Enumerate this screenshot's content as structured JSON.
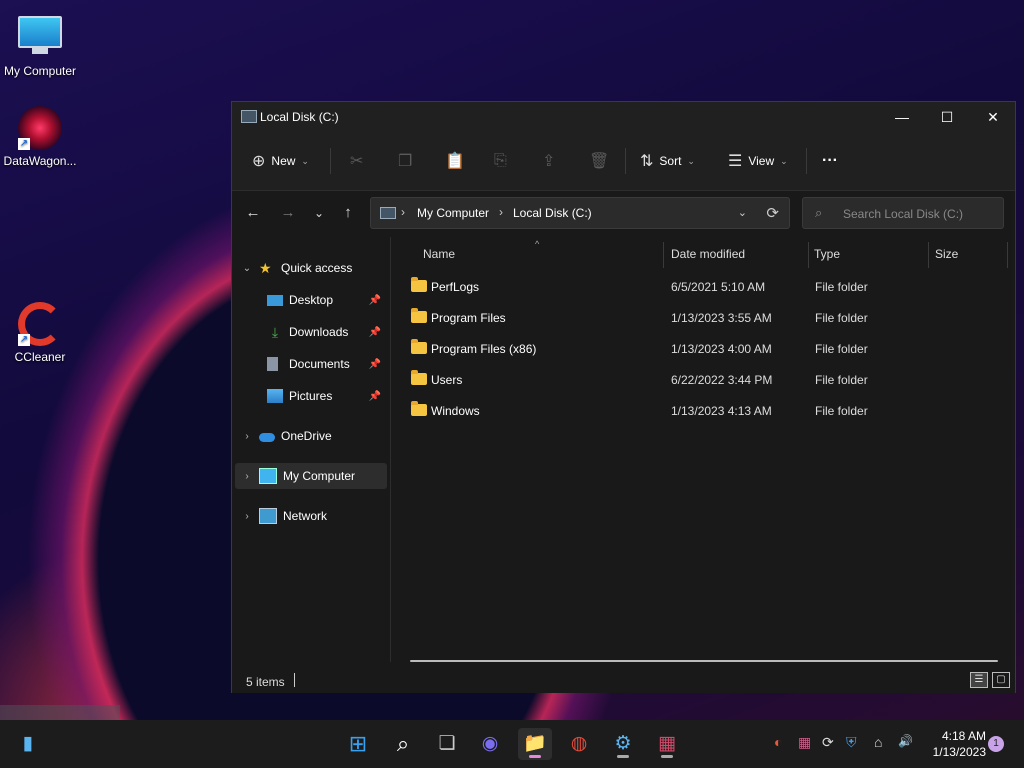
{
  "desktop": {
    "icons": [
      {
        "label": "My Computer",
        "icon": "monitor-icon"
      },
      {
        "label": "DataWagon...",
        "icon": "datawagon-icon"
      },
      {
        "label": "CCleaner",
        "icon": "ccleaner-icon"
      }
    ]
  },
  "window": {
    "title": "Local Disk (C:)",
    "controls": {
      "minimize": "—",
      "maximize": "☐",
      "close": "✕"
    }
  },
  "toolbar": {
    "new_label": "New",
    "sort_label": "Sort",
    "view_label": "View",
    "more_label": "···",
    "icons": {
      "new": "⊕",
      "cut": "✂",
      "copy": "❐",
      "paste": "📋",
      "rename": "⎘",
      "share": "⇪",
      "delete": "🗑",
      "sort": "⇅",
      "view": "☰"
    }
  },
  "nav": {
    "back": "←",
    "forward": "→",
    "recent": "⌄",
    "up": "↑",
    "breadcrumb": [
      "My Computer",
      "Local Disk (C:)"
    ],
    "crumb_sep": "›",
    "refresh": "⟳",
    "search_placeholder": "Search Local Disk (C:)",
    "search_icon": "⌕"
  },
  "sidebar": {
    "quick_access": "Quick access",
    "items": [
      {
        "label": "Desktop",
        "pinned": true
      },
      {
        "label": "Downloads",
        "pinned": true
      },
      {
        "label": "Documents",
        "pinned": true
      },
      {
        "label": "Pictures",
        "pinned": true
      }
    ],
    "onedrive": "OneDrive",
    "my_computer": "My Computer",
    "network": "Network",
    "pin_glyph": "📌",
    "expanded_glyph": "⌄",
    "collapsed_glyph": "›"
  },
  "list": {
    "columns": {
      "name": "Name",
      "date": "Date modified",
      "type": "Type",
      "size": "Size"
    },
    "sort_indicator": "^",
    "rows": [
      {
        "name": "PerfLogs",
        "date": "6/5/2021 5:10 AM",
        "type": "File folder",
        "size": ""
      },
      {
        "name": "Program Files",
        "date": "1/13/2023 3:55 AM",
        "type": "File folder",
        "size": ""
      },
      {
        "name": "Program Files (x86)",
        "date": "1/13/2023 4:00 AM",
        "type": "File folder",
        "size": ""
      },
      {
        "name": "Users",
        "date": "6/22/2022 3:44 PM",
        "type": "File folder",
        "size": ""
      },
      {
        "name": "Windows",
        "date": "1/13/2023 4:13 AM",
        "type": "File folder",
        "size": ""
      }
    ]
  },
  "status": {
    "item_count": "5 items",
    "details_view_glyph": "☰",
    "tiles_view_glyph": "▢"
  },
  "taskbar": {
    "icons": {
      "widgets": "▮",
      "start": "⊞",
      "search": "⌕",
      "task_view": "❏",
      "chat": "◉",
      "explorer": "📁",
      "chrome": "◍",
      "control_panel": "⚙",
      "winrar": "▦"
    },
    "tray": {
      "ccleaner": "◐",
      "winrar": "▦",
      "update": "⟳",
      "defender": "⛨",
      "network": "⌂",
      "volume": "🔊"
    },
    "time": "4:18 AM",
    "date": "1/13/2023",
    "notifications": "1"
  }
}
